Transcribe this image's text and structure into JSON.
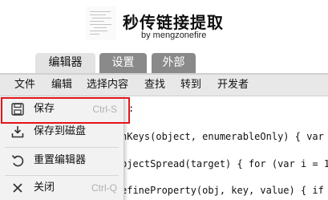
{
  "header": {
    "title": "秒传链接提取",
    "byline": "by mengzonefire"
  },
  "tabs": [
    {
      "label": "编辑器",
      "active": true
    },
    {
      "label": "设置",
      "active": false
    },
    {
      "label": "外部",
      "active": false
    }
  ],
  "menubar": {
    "items": [
      "文件",
      "编辑",
      "选择内容",
      "查找",
      "转到",
      "开发者"
    ]
  },
  "file_menu": {
    "items": [
      {
        "label": "保存",
        "shortcut": "Ctrl-S",
        "icon": "save-icon"
      },
      {
        "label": "保存到磁盘",
        "shortcut": "",
        "icon": "download-icon"
      },
      {
        "label": "重置编辑器",
        "shortcut": "",
        "icon": "undo-icon"
      },
      {
        "label": "关闭",
        "shortcut": "Ctrl-Q",
        "icon": "close-icon"
      }
    ]
  },
  "editor": {
    "lines": [
      ":",
      "nKeys(object, enumerableOnly) { var k",
      "bjectSpread(target) { for (var i = 1;",
      "efineProperty(obj, key, value) { if ("
    ]
  },
  "colors": {
    "highlight_border": "#e3151a",
    "tab_active": "#e3e3e3",
    "tab_inactive": "#8a8a8a",
    "menubar": "#e8e8e8",
    "dropdown_bg": "#f2f2f2",
    "shortcut_text": "#b0b0b0"
  }
}
